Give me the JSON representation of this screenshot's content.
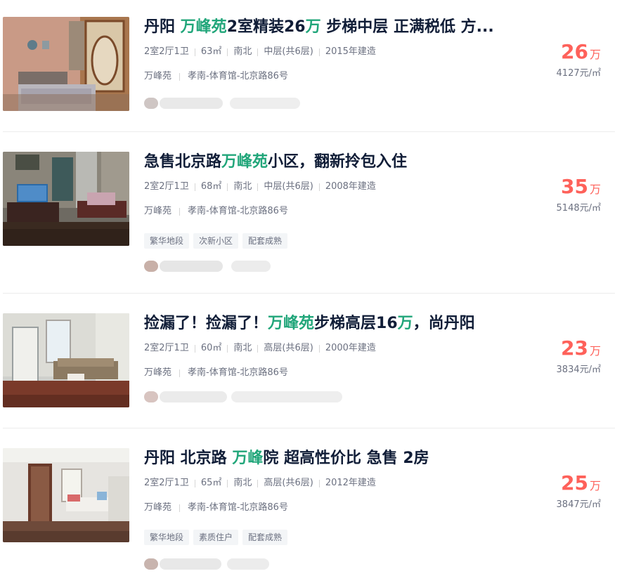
{
  "listings": [
    {
      "title_parts": [
        "丹阳 ",
        "万峰苑",
        "2室精装26",
        "万",
        " 步梯中层 正满税低 方..."
      ],
      "rooms": "2室2厅1卫",
      "area": "63㎡",
      "orientation": "南北",
      "floor": "中层(共6层)",
      "year": "2015年建造",
      "community": "万峰苑",
      "location": "孝南-体育馆-北京路86号",
      "tags": [],
      "price": "26",
      "price_unit": "万",
      "unit_price": "4127元/㎡",
      "photo_icon": "bedroom-photo"
    },
    {
      "title_parts": [
        "急售北京路",
        "万峰苑",
        "小区，翻新拎包入住"
      ],
      "rooms": "2室2厅1卫",
      "area": "68㎡",
      "orientation": "南北",
      "floor": "中层(共6层)",
      "year": "2008年建造",
      "community": "万峰苑",
      "location": "孝南-体育馆-北京路86号",
      "tags": [
        "繁华地段",
        "次新小区",
        "配套成熟"
      ],
      "price": "35",
      "price_unit": "万",
      "unit_price": "5148元/㎡",
      "photo_icon": "living-room-tv-photo"
    },
    {
      "title_parts": [
        "捡漏了！捡漏了！",
        "万峰苑",
        "步梯高层16",
        "万",
        "，尚丹阳"
      ],
      "rooms": "2室2厅1卫",
      "area": "60㎡",
      "orientation": "南北",
      "floor": "高层(共6层)",
      "year": "2000年建造",
      "community": "万峰苑",
      "location": "孝南-体育馆-北京路86号",
      "tags": [],
      "price": "23",
      "price_unit": "万",
      "unit_price": "3834元/㎡",
      "photo_icon": "living-room-sofa-photo"
    },
    {
      "title_parts": [
        "丹阳 北京路 ",
        "万峰",
        "院 超高性价比 急售 2房"
      ],
      "rooms": "2室2厅1卫",
      "area": "65㎡",
      "orientation": "南北",
      "floor": "高层(共6层)",
      "year": "2012年建造",
      "community": "万峰苑",
      "location": "孝南-体育馆-北京路86号",
      "tags": [
        "繁华地段",
        "素质住户",
        "配套成熟"
      ],
      "price": "25",
      "price_unit": "万",
      "unit_price": "3847元/㎡",
      "photo_icon": "living-room-white-photo"
    }
  ],
  "colors": {
    "title": "#101d37",
    "highlight": "#21a67a",
    "price": "#fe615a",
    "meta": "#6b7080"
  }
}
